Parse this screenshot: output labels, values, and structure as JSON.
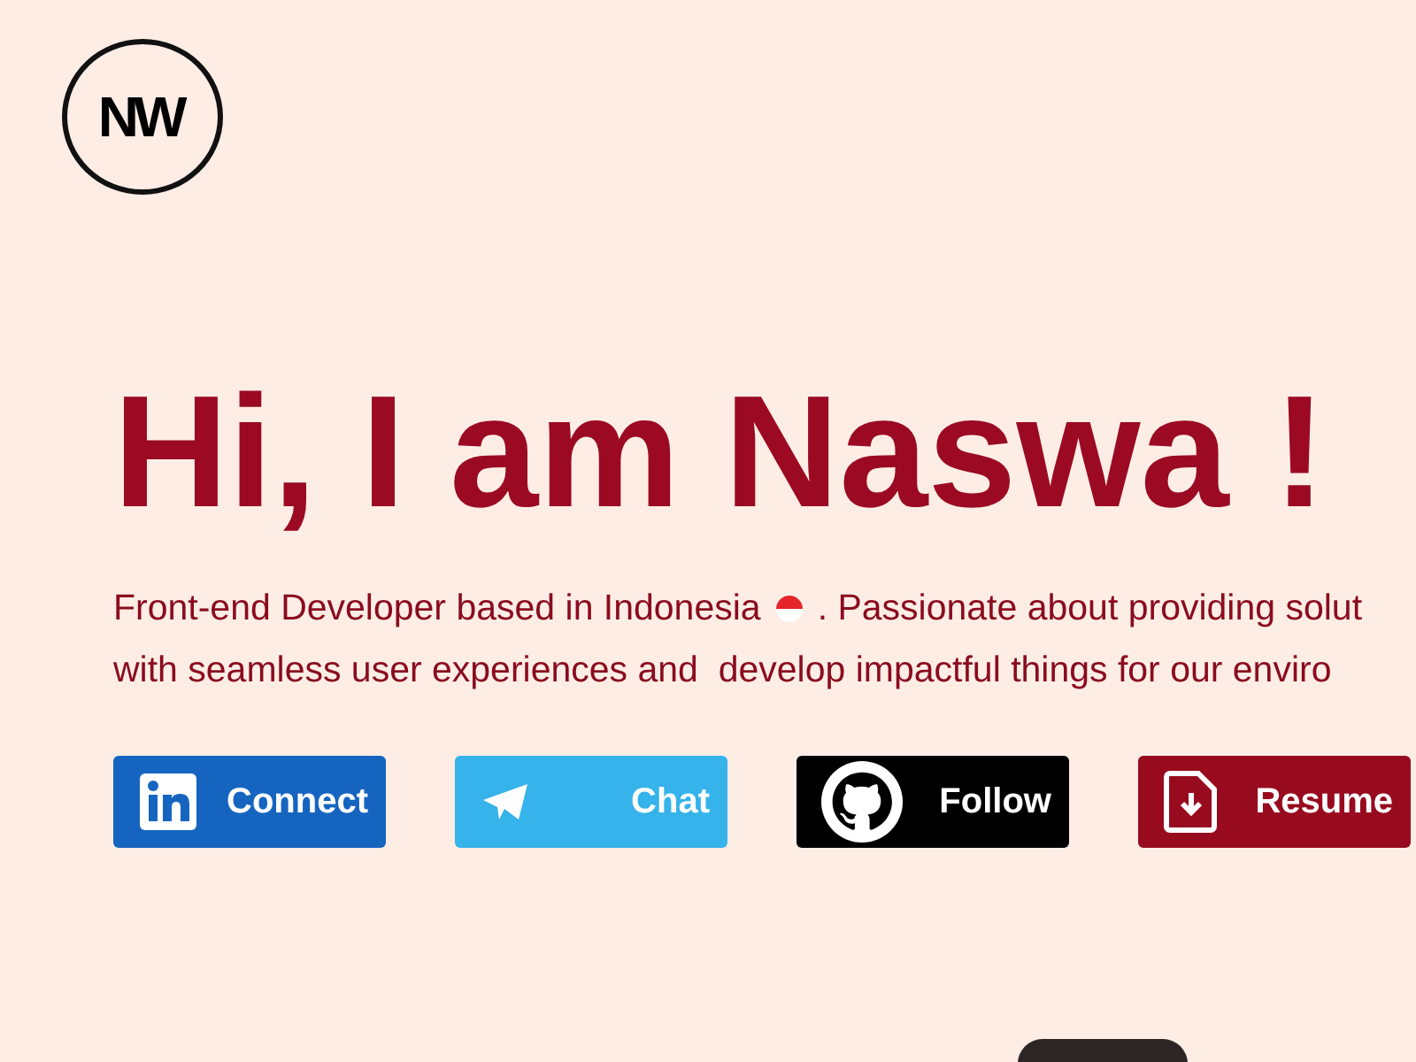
{
  "logo": {
    "text": "NW"
  },
  "hero": {
    "heading": "Hi, I am Naswa !",
    "intro_lines": [
      "Front-end Developer based in Indonesia",
      ". Passionate about providing solut"
    ],
    "second_line": "with seamless user experiences and  develop impactful things for our enviro"
  },
  "buttons": [
    {
      "kind": "linkedin",
      "label": "Connect",
      "color": "#1565c0"
    },
    {
      "kind": "telegram",
      "label": "Chat",
      "color": "#35b3ea"
    },
    {
      "kind": "github",
      "label": "Follow",
      "color": "#000000"
    },
    {
      "kind": "resume",
      "label": "Resume",
      "color": "#980b1f"
    }
  ]
}
